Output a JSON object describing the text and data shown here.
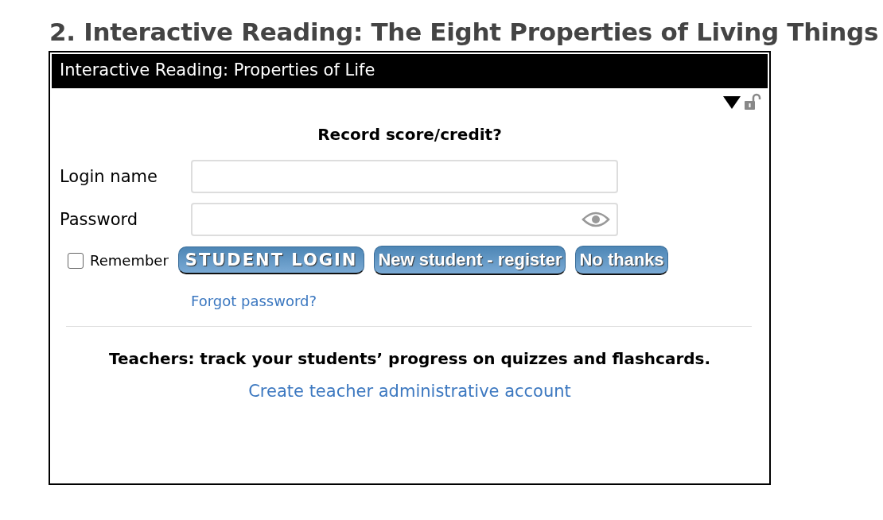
{
  "heading": "2. Interactive Reading: The Eight Properties of Living Things",
  "panel": {
    "title": "Interactive Reading: Properties of Life",
    "prompt": "Record score/credit?",
    "fields": [
      {
        "label": "Login name",
        "kind": "text"
      },
      {
        "label": "Password",
        "kind": "password"
      }
    ],
    "remember": {
      "label": "Remember",
      "checked": false
    },
    "buttons": [
      {
        "label": "STUDENT LOGIN",
        "kind": "primary"
      },
      {
        "label": "New student - register",
        "kind": "secondary"
      },
      {
        "label": "No thanks",
        "kind": "secondary"
      }
    ],
    "forgot_link": "Forgot password?",
    "teachers_note": "Teachers: track your students’ progress on quizzes and flashcards.",
    "teacher_link": "Create teacher administrative account"
  }
}
